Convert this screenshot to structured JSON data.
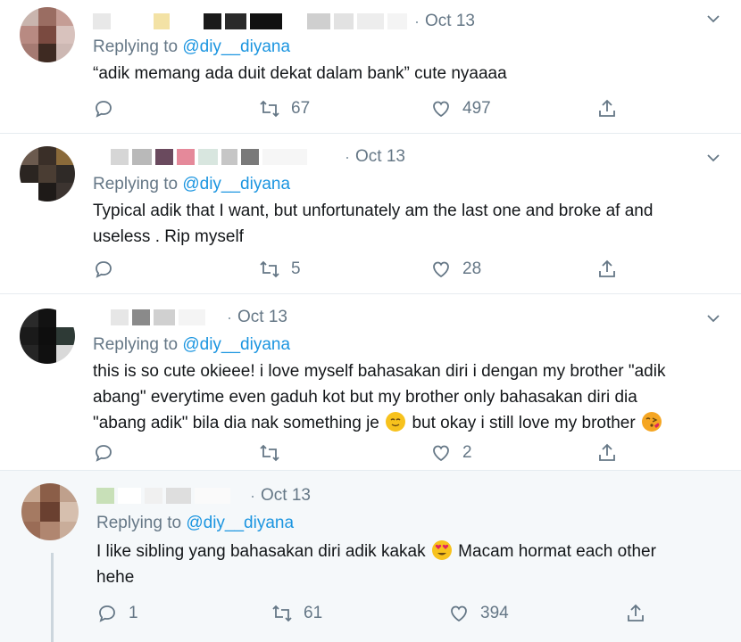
{
  "tweets": [
    {
      "date": "Oct 13",
      "replying_prefix": "Replying to ",
      "replying_handle": "@diy__diyana",
      "text_lines": [
        "“adik memang ada duit dekat dalam bank” cute nyaaaa"
      ],
      "reply_count": "",
      "retweet_count": "67",
      "like_count": "497"
    },
    {
      "date": "Oct 13",
      "replying_prefix": "Replying to ",
      "replying_handle": "@diy__diyana",
      "text_lines": [
        "Typical adik that I want, but unfortunately am the last one and broke af and",
        "useless . Rip myself"
      ],
      "reply_count": "",
      "retweet_count": "5",
      "like_count": "28"
    },
    {
      "date": "Oct 13",
      "replying_prefix": "Replying to ",
      "replying_handle": "@diy__diyana",
      "line1": "this is so cute okieee! i love myself bahasakan diri i dengan my brother \"adik",
      "line2": "abang\" everytime even gaduh kot but my brother only bahasakan diri dia",
      "line3a": "\"abang adik\" bila dia nak something je",
      "line3b": "but okay i still love my brother",
      "reply_count": "",
      "retweet_count": "",
      "like_count": "2"
    },
    {
      "date": "Oct 13",
      "replying_prefix": "Replying to ",
      "replying_handle": "@diy__diyana",
      "line1a": "I like sibling yang bahasakan diri adik kakak",
      "line1b": "Macam hormat each other",
      "line2": "hehe",
      "reply_count": "1",
      "retweet_count": "61",
      "like_count": "394"
    }
  ],
  "icons": [
    "reply-icon",
    "retweet-icon",
    "like-icon",
    "share-icon",
    "chevron-down-icon"
  ],
  "colors": {
    "handle": "#1b95e0",
    "muted": "#657786",
    "divider": "#e6ecf0",
    "highlight_bg": "#f5f8fa"
  }
}
